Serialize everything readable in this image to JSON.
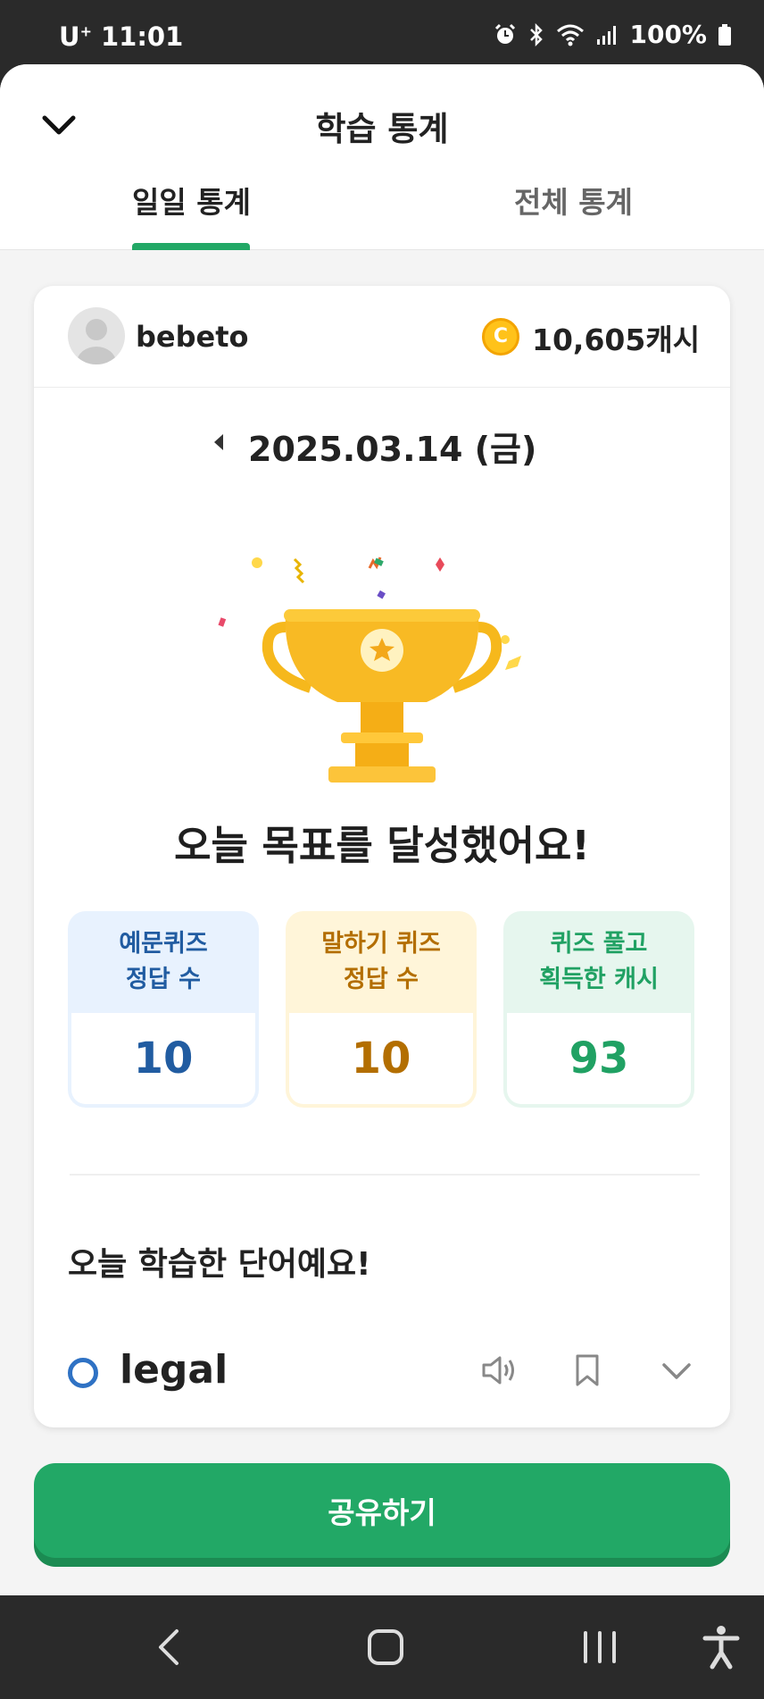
{
  "status_bar": {
    "carrier": "U",
    "carrier_sup": "+",
    "time": "11:01",
    "battery": "100%"
  },
  "header": {
    "title": "학습 통계",
    "tabs": [
      {
        "label": "일일 통계",
        "active": true
      },
      {
        "label": "전체 통계",
        "active": false
      }
    ]
  },
  "profile": {
    "username": "bebeto",
    "coin_symbol": "C",
    "cash": "10,605캐시"
  },
  "date": "2025.03.14 (금)",
  "goal_message": "오늘 목표를 달성했어요!",
  "stats": [
    {
      "label_line1": "예문퀴즈",
      "label_line2": "정답 수",
      "value": "10",
      "color": "#215ca1"
    },
    {
      "label_line1": "말하기 퀴즈",
      "label_line2": "정답 수",
      "value": "10",
      "color": "#b36e00"
    },
    {
      "label_line1": "퀴즈 풀고",
      "label_line2": "획득한 캐시",
      "value": "93",
      "color": "#20a163"
    }
  ],
  "words_section": {
    "title": "오늘 학습한 단어예요!",
    "items": [
      {
        "word": "legal"
      }
    ]
  },
  "share_button": "공유하기",
  "colors": {
    "accent": "#22a866",
    "coin": "#ffc21a"
  }
}
